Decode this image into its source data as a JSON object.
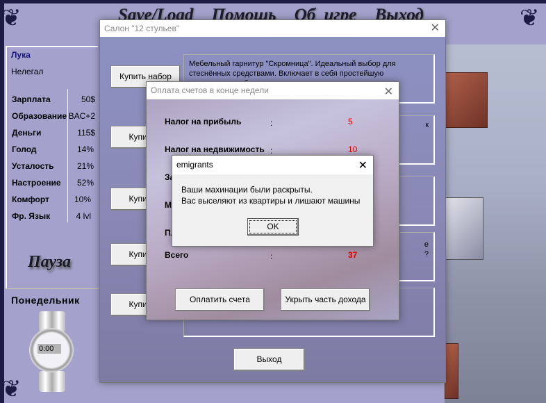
{
  "menu": {
    "items": [
      "Save/Load",
      "Помощь",
      "Об игре",
      "Выход"
    ]
  },
  "player": {
    "name": "Лука",
    "status": "Нелегал",
    "stats": [
      {
        "label": "Зарплата",
        "value": "50$"
      },
      {
        "label": "Образование",
        "value": "BAC+2"
      },
      {
        "label": "Деньги",
        "value": "115$"
      },
      {
        "label": "Голод",
        "value": "14%"
      },
      {
        "label": "Усталость",
        "value": "21%"
      },
      {
        "label": "Настроение",
        "value": "52%"
      },
      {
        "label": "Комфорт",
        "value": "10%"
      },
      {
        "label": "Фр. Язык",
        "value": "4 lvl"
      }
    ],
    "pause_label": "Пауза",
    "day": "Понедельник",
    "clock": "0:00"
  },
  "salon": {
    "title": "Салон \"12 стульев\"",
    "buy_buttons": [
      "Купить набор",
      "Купить н",
      "Купить н",
      "Купить н",
      "Купить н"
    ],
    "descriptions": [
      "Мебельный гарнитур \"Скромница\". Идеальный выбор для стеснённых средствами. Включает в себя простейшую деревянную мебель.",
      "к",
      "",
      "е\n?",
      ""
    ],
    "exit_label": "Выход"
  },
  "bills": {
    "title": "Оплата счетов в конце недели",
    "rows": [
      {
        "label": "Налог на прибыль",
        "value": "5"
      },
      {
        "label": "Налог на недвижимость",
        "value": "10"
      },
      {
        "label": "За",
        "value": ""
      },
      {
        "label": "М",
        "value": ""
      },
      {
        "label": "Пл",
        "value": ""
      },
      {
        "label": "Всего",
        "value": "37"
      }
    ],
    "colon": ":",
    "pay_label": "Оплатить счета",
    "hide_label": "Укрыть часть дохода"
  },
  "message": {
    "title": "emigrants",
    "line1": "Ваши махинации были раскрыты.",
    "line2": "Вас выселяют из квартиры и лишают машины",
    "ok_label": "OK"
  },
  "icons": {
    "close": "close-icon",
    "ornament": "ornament-icon",
    "watch": "watch-icon"
  }
}
